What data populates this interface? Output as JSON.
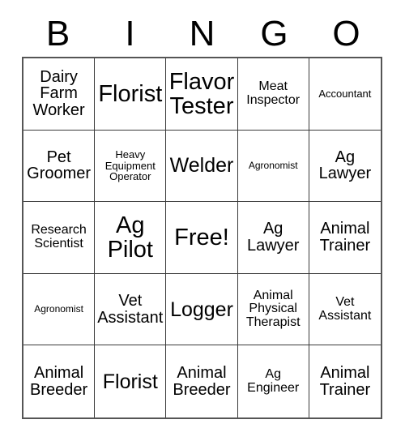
{
  "card": {
    "title": "BINGO",
    "free_space_label": "Free!",
    "header_letters": [
      "B",
      "I",
      "N",
      "G",
      "O"
    ],
    "columns": 5,
    "rows": 5,
    "colors": {
      "background": "#ffffff",
      "text": "#000000",
      "grid_line": "#3a3a3a",
      "outer_border": "#555555"
    }
  },
  "grid": {
    "rows": [
      {
        "cells": [
          {
            "label": "Dairy\nFarm\nWorker",
            "text": "Dairy Farm Worker",
            "size": "md",
            "free": false
          },
          {
            "label": "Florist",
            "text": "Florist",
            "size": "xl",
            "free": false
          },
          {
            "label": "Flavor\nTester",
            "text": "Flavor Tester",
            "size": "xl",
            "free": false
          },
          {
            "label": "Meat\nInspector",
            "text": "Meat Inspector",
            "size": "sm",
            "free": false
          },
          {
            "label": "Accountant",
            "text": "Accountant",
            "size": "xs",
            "free": false
          }
        ]
      },
      {
        "cells": [
          {
            "label": "Pet\nGroomer",
            "text": "Pet Groomer",
            "size": "md",
            "free": false
          },
          {
            "label": "Heavy\nEquipment\nOperator",
            "text": "Heavy Equipment Operator",
            "size": "xs",
            "free": false
          },
          {
            "label": "Welder",
            "text": "Welder",
            "size": "lg",
            "free": false
          },
          {
            "label": "Agronomist",
            "text": "Agronomist",
            "size": "xxs",
            "free": false
          },
          {
            "label": "Ag\nLawyer",
            "text": "Ag Lawyer",
            "size": "md",
            "free": false
          }
        ]
      },
      {
        "cells": [
          {
            "label": "Research\nScientist",
            "text": "Research Scientist",
            "size": "sm",
            "free": false
          },
          {
            "label": "Ag\nPilot",
            "text": "Ag Pilot",
            "size": "xl",
            "free": false
          },
          {
            "label": "Free!",
            "text": "Free!",
            "size": "xl",
            "free": true
          },
          {
            "label": "Ag\nLawyer",
            "text": "Ag Lawyer",
            "size": "md",
            "free": false
          },
          {
            "label": "Animal\nTrainer",
            "text": "Animal Trainer",
            "size": "md",
            "free": false
          }
        ]
      },
      {
        "cells": [
          {
            "label": "Agronomist",
            "text": "Agronomist",
            "size": "xxs",
            "free": false
          },
          {
            "label": "Vet\nAssistant",
            "text": "Vet Assistant",
            "size": "md",
            "free": false
          },
          {
            "label": "Logger",
            "text": "Logger",
            "size": "lg",
            "free": false
          },
          {
            "label": "Animal\nPhysical\nTherapist",
            "text": "Animal Physical Therapist",
            "size": "sm",
            "free": false
          },
          {
            "label": "Vet\nAssistant",
            "text": "Vet Assistant",
            "size": "sm",
            "free": false
          }
        ]
      },
      {
        "cells": [
          {
            "label": "Animal\nBreeder",
            "text": "Animal Breeder",
            "size": "md",
            "free": false
          },
          {
            "label": "Florist",
            "text": "Florist",
            "size": "lg",
            "free": false
          },
          {
            "label": "Animal\nBreeder",
            "text": "Animal Breeder",
            "size": "md",
            "free": false
          },
          {
            "label": "Ag\nEngineer",
            "text": "Ag Engineer",
            "size": "sm",
            "free": false
          },
          {
            "label": "Animal\nTrainer",
            "text": "Animal Trainer",
            "size": "md",
            "free": false
          }
        ]
      }
    ]
  }
}
